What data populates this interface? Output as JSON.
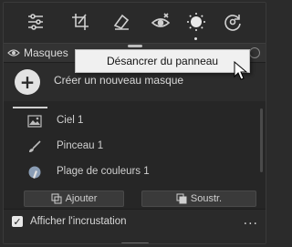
{
  "toolbar": {
    "tools": [
      {
        "name": "sliders-icon"
      },
      {
        "name": "crop-icon"
      },
      {
        "name": "eraser-icon"
      },
      {
        "name": "redeye-icon"
      },
      {
        "name": "masking-icon",
        "active": true
      },
      {
        "name": "reset-icon"
      }
    ]
  },
  "panel": {
    "title": "Masques"
  },
  "create": {
    "label": "Créer un nouveau masque"
  },
  "masks": [
    {
      "label": "Ciel 1",
      "icon": "sky-icon"
    },
    {
      "label": "Pinceau 1",
      "icon": "brush-icon"
    },
    {
      "label": "Plage de couleurs 1",
      "icon": "color-range-icon"
    }
  ],
  "actions": {
    "add_label": "Ajouter",
    "subtract_label": "Soustr."
  },
  "footer": {
    "overlay_label": "Afficher l'incrustation",
    "overlay_checked": true,
    "more_label": "..."
  },
  "context_menu": {
    "item_label": "Désancrer du panneau"
  },
  "colors": {
    "panel_bg": "#262626",
    "menu_bg": "#f0f0f0",
    "accent": "#e2e2e2"
  }
}
